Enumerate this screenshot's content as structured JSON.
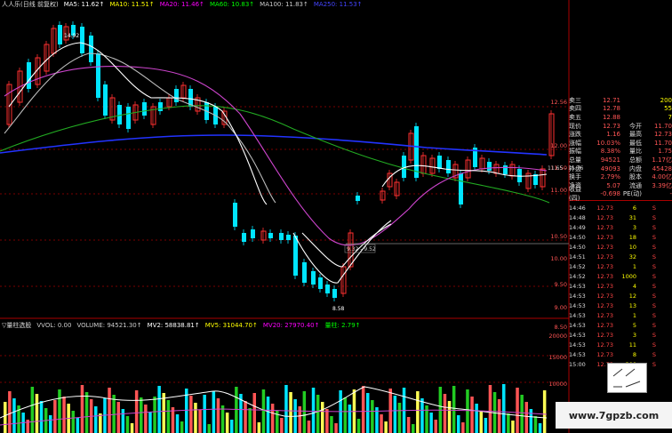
{
  "legend": {
    "title": "人人乐(日线 前复权)",
    "ma5": "MA5: 11.62↑",
    "ma10": "MA10: 11.51↑",
    "ma20": "MA20: 11.46↑",
    "ma60": "MA60: 10.83↑",
    "ma100": "MA100: 11.83↑",
    "ma250": "MA250: 11.53↑"
  },
  "vol_legend": {
    "title": "▽量柱选股",
    "vvol": "VVOL: 0.00",
    "volume": "VOLUME: 94521.30↑",
    "mv2": "MV2: 58838.81↑",
    "mv5": "MV5: 31044.70↑",
    "mv20": "MV20: 27970.40↑",
    "liangzhu": "量柱: 2.79↑"
  },
  "price_axis": [
    "12.56",
    "12.00",
    "11.50",
    "11.00",
    "10.50",
    "10.00",
    "9.50",
    "9.00",
    "8.50"
  ],
  "vol_axis": [
    "20000",
    "15000",
    "10000"
  ],
  "annotations": {
    "high": "14.92",
    "low": "8.58",
    "box": "9.32 - 9.52",
    "right": "11.65 - 11.76"
  },
  "quote": [
    {
      "k": "卖三",
      "v": "12.71",
      "n": "200"
    },
    {
      "k": "卖四",
      "v": "12.78",
      "n": "55"
    },
    {
      "k": "卖五",
      "v": "12.88",
      "n": "7"
    },
    {
      "k": "现价",
      "v": "12.73",
      "k2": "今开",
      "v2": "11.70"
    },
    {
      "k": "涨跌",
      "v": "1.16",
      "k2": "最高",
      "v2": "12.73"
    },
    {
      "k": "涨幅",
      "v": "10.03%",
      "k2": "最低",
      "v2": "11.70"
    },
    {
      "k": "振幅",
      "v": "8.38%",
      "k2": "量比",
      "v2": "1.75"
    },
    {
      "k": "总量",
      "v": "94521",
      "k2": "总额",
      "v2": "1.17亿"
    },
    {
      "k": "外盘",
      "v": "49093",
      "k2": "内盘",
      "v2": "45428"
    },
    {
      "k": "换手",
      "v": "2.79%",
      "k2": "股本",
      "v2": "4.00亿"
    },
    {
      "k": "净资",
      "v": "5.07",
      "k2": "流通",
      "v2": "3.39亿"
    },
    {
      "k": "收益(四)",
      "v": "-0.698",
      "k2": "PE(动)",
      "v2": "-"
    }
  ],
  "ticks": [
    {
      "t": "14:46",
      "p": "12.73",
      "v": "6",
      "s": "S"
    },
    {
      "t": "14:48",
      "p": "12.73",
      "v": "31",
      "s": "S"
    },
    {
      "t": "14:49",
      "p": "12.73",
      "v": "3",
      "s": "S"
    },
    {
      "t": "14:50",
      "p": "12.73",
      "v": "18",
      "s": "S"
    },
    {
      "t": "14:50",
      "p": "12.73",
      "v": "10",
      "s": "S"
    },
    {
      "t": "14:51",
      "p": "12.73",
      "v": "32",
      "s": "S"
    },
    {
      "t": "14:52",
      "p": "12.73",
      "v": "1",
      "s": "S"
    },
    {
      "t": "14:52",
      "p": "12.73",
      "v": "1000",
      "s": "S"
    },
    {
      "t": "14:53",
      "p": "12.73",
      "v": "4",
      "s": "S"
    },
    {
      "t": "14:53",
      "p": "12.73",
      "v": "12",
      "s": "S"
    },
    {
      "t": "14:53",
      "p": "12.73",
      "v": "13",
      "s": "S"
    },
    {
      "t": "14:53",
      "p": "12.73",
      "v": "1",
      "s": "S"
    },
    {
      "t": "14:53",
      "p": "12.73",
      "v": "5",
      "s": "S"
    },
    {
      "t": "14:53",
      "p": "12.73",
      "v": "3",
      "s": "S"
    },
    {
      "t": "14:53",
      "p": "12.73",
      "v": "11",
      "s": "S"
    },
    {
      "t": "14:53",
      "p": "12.73",
      "v": "8",
      "s": "S"
    },
    {
      "t": "15:00",
      "p": "12.73",
      "v": "300",
      "s": "S"
    }
  ],
  "watermark": "www.7gpzb.com",
  "colors": {
    "up": "#ff3030",
    "down": "#00e5ff",
    "ma5": "#ffffff",
    "ma10": "#cccccc",
    "ma20": "#cc44cc",
    "ma60": "#22aa22",
    "ma100": "#2233ff",
    "grid": "#8b0000"
  }
}
